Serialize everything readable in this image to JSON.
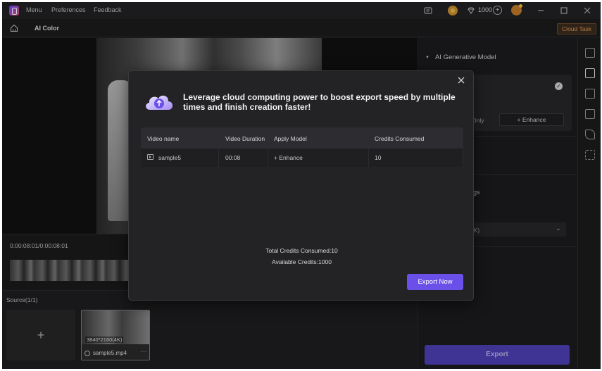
{
  "titlebar": {
    "menu": [
      "Menu",
      "Preferences",
      "Feedback"
    ],
    "credits": "1000"
  },
  "subbar": {
    "title": "AI Color",
    "cloud_task": "Cloud Task"
  },
  "timeline": {
    "timecode": "0:00:08:01/0:00:08:01"
  },
  "source": {
    "label": "Source(1/1)",
    "add_symbol": "+",
    "file": {
      "resolution": "3840*2160(4K)",
      "name": "sample5.mp4",
      "more": "···"
    }
  },
  "right_panel": {
    "header": "AI Generative Model",
    "only_partial": "Only",
    "enhance_option": "+ Enhance",
    "settings_partial": "gs",
    "select_partial": "4K)",
    "export": "Export"
  },
  "modal": {
    "title": "Leverage cloud computing power to boost export speed by multiple times and finish creation faster!",
    "columns": [
      "Video name",
      "Video Duration",
      "Apply Model",
      "Credits Consumed"
    ],
    "rows": [
      {
        "name": "sample5",
        "duration": "00:08",
        "model": "+ Enhance",
        "credits": "10"
      }
    ],
    "total": "Total Credits Consumed:10",
    "available": "Available Credits:1000",
    "export_now": "Export Now"
  },
  "colors": {
    "accent": "#6a50e8",
    "export_disabled": "#4e3fb4",
    "cloud_task": "#d89a5a"
  }
}
